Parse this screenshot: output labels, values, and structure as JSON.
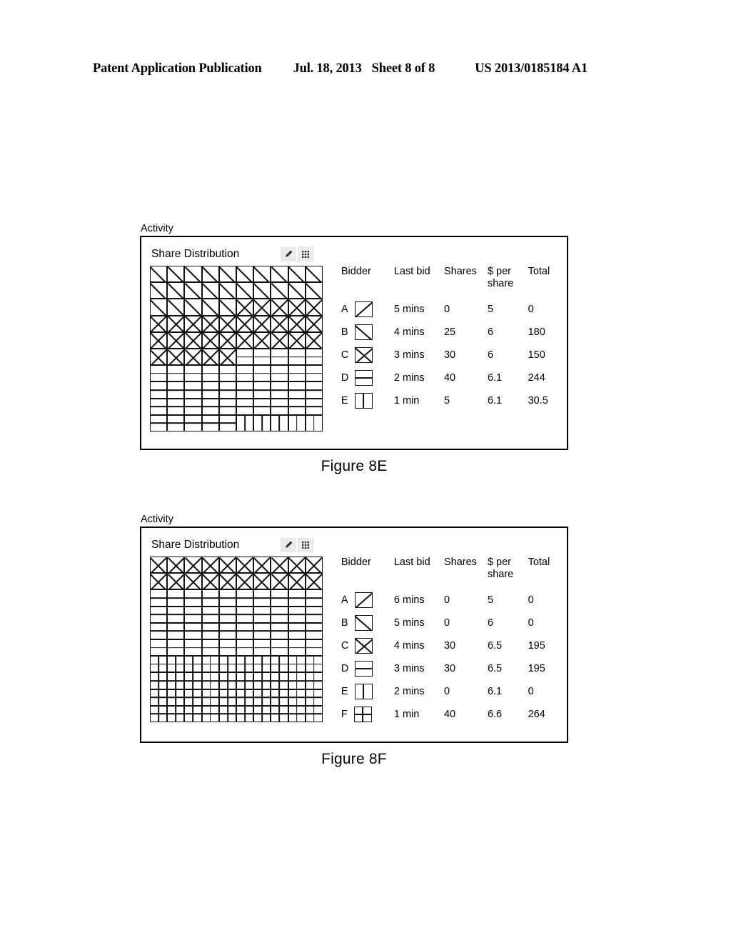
{
  "page_header": {
    "publication": "Patent Application Publication",
    "date": "Jul. 18, 2013",
    "sheet": "Sheet 8 of 8",
    "patent_number": "US 2013/0185184 A1"
  },
  "legend_patterns": {
    "A": "diagonal-forward-slash",
    "B": "diagonal-backslash",
    "C": "diagonal-cross",
    "D": "horizontal-split",
    "E": "vertical-split",
    "F": "quad-split"
  },
  "figures": [
    {
      "id": "8e",
      "activity_label": "Activity",
      "panel_title": "Share Distribution",
      "toolbar": [
        {
          "name": "ink-dropper-icon",
          "glyph": "◈"
        },
        {
          "name": "grid-dots-icon",
          "glyph": "∷"
        }
      ],
      "caption": "Figure 8E",
      "table": {
        "headers": {
          "bidder": "Bidder",
          "last_bid": "Last bid",
          "shares": "Shares",
          "price_line1": "$ per",
          "price_line2": "share",
          "total": "Total"
        },
        "rows": [
          {
            "bidder": "A",
            "pattern": "A",
            "last_bid": "5 mins",
            "shares": "0",
            "price": "5",
            "total": "0"
          },
          {
            "bidder": "B",
            "pattern": "B",
            "last_bid": "4 mins",
            "shares": "25",
            "price": "6",
            "total": "180"
          },
          {
            "bidder": "C",
            "pattern": "C",
            "last_bid": "3 mins",
            "shares": "30",
            "price": "6",
            "total": "150"
          },
          {
            "bidder": "D",
            "pattern": "D",
            "last_bid": "2 mins",
            "shares": "40",
            "price": "6.1",
            "total": "244"
          },
          {
            "bidder": "E",
            "pattern": "E",
            "last_bid": "1 min",
            "shares": "5",
            "price": "6.1",
            "total": "30.5"
          }
        ]
      },
      "grid": {
        "columns": 10,
        "rows": 10,
        "cells": [
          [
            "B",
            "B",
            "B",
            "B",
            "B",
            "B",
            "B",
            "B",
            "B",
            "B"
          ],
          [
            "B",
            "B",
            "B",
            "B",
            "B",
            "B",
            "B",
            "B",
            "B",
            "B"
          ],
          [
            "B",
            "B",
            "B",
            "B",
            "B",
            "C",
            "C",
            "C",
            "C",
            "C"
          ],
          [
            "C",
            "C",
            "C",
            "C",
            "C",
            "C",
            "C",
            "C",
            "C",
            "C"
          ],
          [
            "C",
            "C",
            "C",
            "C",
            "C",
            "C",
            "C",
            "C",
            "C",
            "C"
          ],
          [
            "C",
            "C",
            "C",
            "C",
            "C",
            "D",
            "D",
            "D",
            "D",
            "D"
          ],
          [
            "D",
            "D",
            "D",
            "D",
            "D",
            "D",
            "D",
            "D",
            "D",
            "D"
          ],
          [
            "D",
            "D",
            "D",
            "D",
            "D",
            "D",
            "D",
            "D",
            "D",
            "D"
          ],
          [
            "D",
            "D",
            "D",
            "D",
            "D",
            "D",
            "D",
            "D",
            "D",
            "D"
          ],
          [
            "D",
            "D",
            "D",
            "D",
            "D",
            "E",
            "E",
            "E",
            "E",
            "E"
          ]
        ]
      }
    },
    {
      "id": "8f",
      "activity_label": "Activity",
      "panel_title": "Share Distribution",
      "toolbar": [
        {
          "name": "ink-dropper-icon",
          "glyph": "◈"
        },
        {
          "name": "grid-dots-icon",
          "glyph": "∷"
        }
      ],
      "caption": "Figure 8F",
      "table": {
        "headers": {
          "bidder": "Bidder",
          "last_bid": "Last bid",
          "shares": "Shares",
          "price_line1": "$ per",
          "price_line2": "share",
          "total": "Total"
        },
        "rows": [
          {
            "bidder": "A",
            "pattern": "A",
            "last_bid": "6 mins",
            "shares": "0",
            "price": "5",
            "total": "0"
          },
          {
            "bidder": "B",
            "pattern": "B",
            "last_bid": "5 mins",
            "shares": "0",
            "price": "6",
            "total": "0"
          },
          {
            "bidder": "C",
            "pattern": "C",
            "last_bid": "4 mins",
            "shares": "30",
            "price": "6.5",
            "total": "195"
          },
          {
            "bidder": "D",
            "pattern": "D",
            "last_bid": "3 mins",
            "shares": "30",
            "price": "6.5",
            "total": "195"
          },
          {
            "bidder": "E",
            "pattern": "E",
            "last_bid": "2 mins",
            "shares": "0",
            "price": "6.1",
            "total": "0"
          },
          {
            "bidder": "F",
            "pattern": "F",
            "last_bid": "1 min",
            "shares": "40",
            "price": "6.6",
            "total": "264"
          }
        ]
      },
      "grid": {
        "columns": 10,
        "rows": 10,
        "cells": [
          [
            "C",
            "C",
            "C",
            "C",
            "C",
            "C",
            "C",
            "C",
            "C",
            "C"
          ],
          [
            "C",
            "C",
            "C",
            "C",
            "C",
            "C",
            "C",
            "C",
            "C",
            "C"
          ],
          [
            "D",
            "D",
            "D",
            "D",
            "D",
            "D",
            "D",
            "D",
            "D",
            "D"
          ],
          [
            "D",
            "D",
            "D",
            "D",
            "D",
            "D",
            "D",
            "D",
            "D",
            "D"
          ],
          [
            "D",
            "D",
            "D",
            "D",
            "D",
            "D",
            "D",
            "D",
            "D",
            "D"
          ],
          [
            "D",
            "D",
            "D",
            "D",
            "D",
            "D",
            "D",
            "D",
            "D",
            "D"
          ],
          [
            "F",
            "F",
            "F",
            "F",
            "F",
            "F",
            "F",
            "F",
            "F",
            "F"
          ],
          [
            "F",
            "F",
            "F",
            "F",
            "F",
            "F",
            "F",
            "F",
            "F",
            "F"
          ],
          [
            "F",
            "F",
            "F",
            "F",
            "F",
            "F",
            "F",
            "F",
            "F",
            "F"
          ],
          [
            "F",
            "F",
            "F",
            "F",
            "F",
            "F",
            "F",
            "F",
            "F",
            "F"
          ]
        ]
      }
    }
  ]
}
